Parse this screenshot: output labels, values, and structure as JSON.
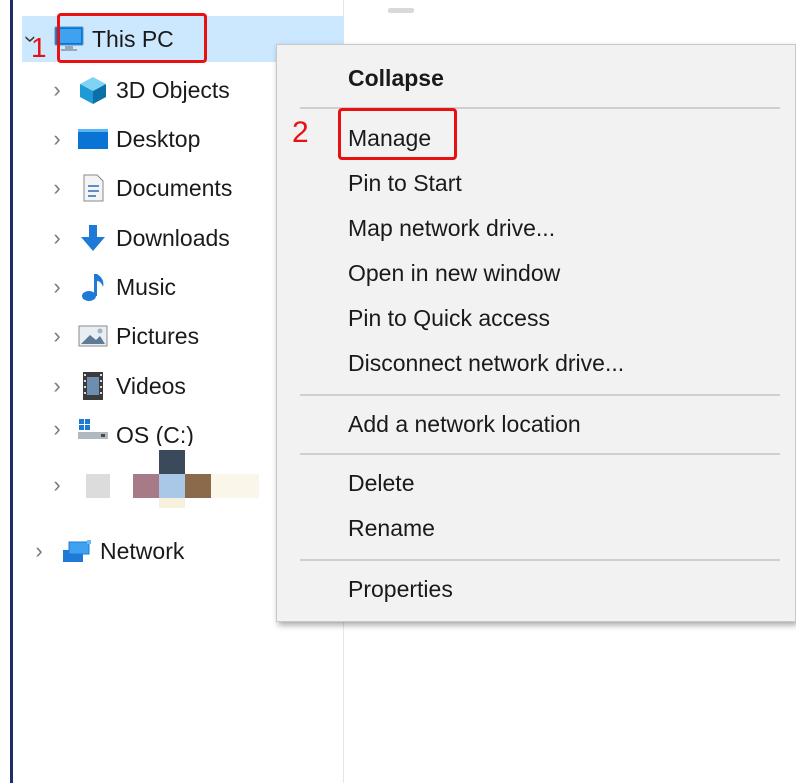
{
  "nav": {
    "this_pc": "This PC",
    "items": [
      {
        "label": "3D Objects",
        "icon": "3d-objects-icon"
      },
      {
        "label": "Desktop",
        "icon": "desktop-icon"
      },
      {
        "label": "Documents",
        "icon": "documents-icon"
      },
      {
        "label": "Downloads",
        "icon": "downloads-icon"
      },
      {
        "label": "Music",
        "icon": "music-icon"
      },
      {
        "label": "Pictures",
        "icon": "pictures-icon"
      },
      {
        "label": "Videos",
        "icon": "videos-icon"
      },
      {
        "label": "OS (C:)",
        "icon": "drive-icon"
      }
    ],
    "network": "Network"
  },
  "annotations": {
    "step1": "1",
    "step2": "2",
    "color": "#e81010"
  },
  "context_menu": {
    "collapse": "Collapse",
    "manage": "Manage",
    "pin_to_start": "Pin to Start",
    "map_network_drive": "Map network drive...",
    "open_in_new_window": "Open in new window",
    "pin_to_quick_access": "Pin to Quick access",
    "disconnect_network_drive": "Disconnect network drive...",
    "add_network_location": "Add a network location",
    "delete": "Delete",
    "rename": "Rename",
    "properties": "Properties"
  },
  "colors": {
    "selection": "#cce8ff",
    "menu_background": "#f2f2f2",
    "windows_blue": "#0078d7"
  }
}
